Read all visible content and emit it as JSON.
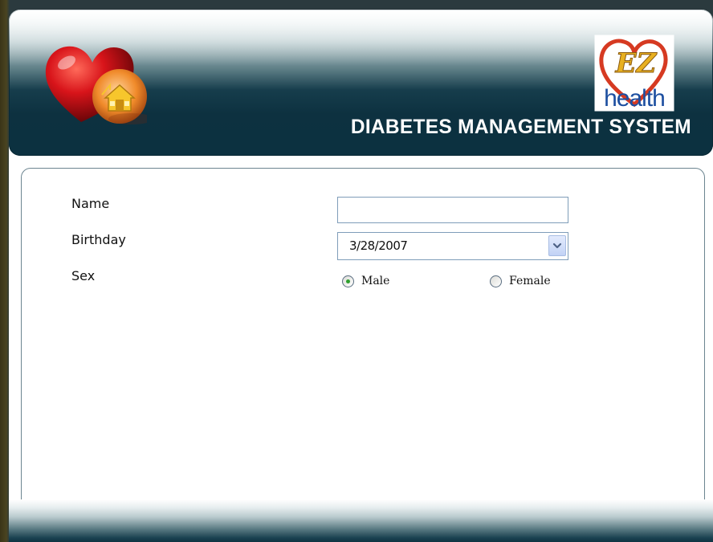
{
  "header": {
    "title": "DIABETES MANAGEMENT SYSTEM",
    "brand_logo_text_top": "EZ",
    "brand_logo_text_bottom": "health",
    "home_icon": "heart-home-icon"
  },
  "form": {
    "name_label": "Name",
    "name_value": "",
    "birthday_label": "Birthday",
    "birthday_value": "3/28/2007",
    "sex_label": "Sex",
    "sex_options": [
      {
        "label": "Male",
        "selected": true
      },
      {
        "label": "Female",
        "selected": false
      }
    ]
  },
  "colors": {
    "header_dark": "#0c3140",
    "accent_radio": "#2fa02f",
    "input_border": "#7f9db9"
  }
}
